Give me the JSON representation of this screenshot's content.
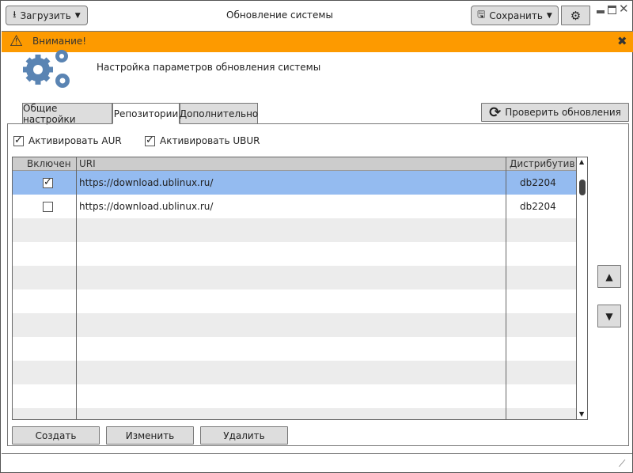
{
  "window": {
    "title": "Обновление системы"
  },
  "toolbar": {
    "load_label": "Загрузить",
    "save_label": "Сохранить"
  },
  "alert": {
    "text": "Внимание!"
  },
  "header": {
    "subtitle": "Настройка параметров обновления системы"
  },
  "tabs": [
    {
      "label": "Общие настройки"
    },
    {
      "label": "Репозитории"
    },
    {
      "label": "Дополнительно"
    }
  ],
  "check_updates_label": "Проверить обновления",
  "options": {
    "aur_label": "Активировать AUR",
    "aur_checked": true,
    "ubur_label": "Активировать UBUR",
    "ubur_checked": true
  },
  "table": {
    "columns": [
      "Включен",
      "URI",
      "Дистрибутив"
    ],
    "rows": [
      {
        "enabled": true,
        "uri": "https://download.ublinux.ru/",
        "dist": "db2204",
        "selected": true
      },
      {
        "enabled": false,
        "uri": "https://download.ublinux.ru/",
        "dist": "db2204",
        "selected": false
      }
    ]
  },
  "actions": {
    "create": "Создать",
    "edit": "Изменить",
    "delete": "Удалить"
  },
  "colors": {
    "accent": "#fd9a00",
    "selection": "#94bbf0",
    "icon": "#5a84b3"
  }
}
